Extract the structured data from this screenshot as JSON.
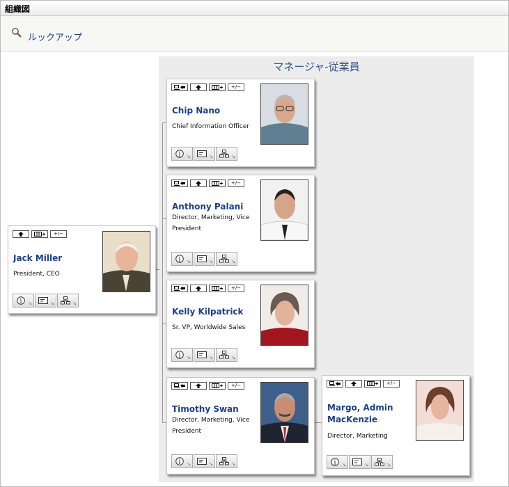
{
  "app": {
    "title": "組織図"
  },
  "toolbar": {
    "lookup_label": "ルックアップ"
  },
  "panel": {
    "title": "マネージャ-従業員"
  },
  "colors": {
    "link": "#1b3f8f",
    "panel_bg": "#ececec",
    "panel_title": "#35588f"
  },
  "icons": {
    "top_buttons": [
      "go-to-manager-icon",
      "up-arrow-icon",
      "show-team-icon",
      "expand-collapse-icon"
    ],
    "bottom_buttons": [
      "info-icon",
      "email-icon",
      "org-chart-icon"
    ]
  },
  "expand_label": "+/−",
  "root": {
    "name": "Jack Miller",
    "title_lines": [
      "President, CEO"
    ]
  },
  "employees": [
    {
      "name": "Chip Nano",
      "title_lines": [
        "Chief Information Officer"
      ]
    },
    {
      "name": "Anthony Palani",
      "title_lines": [
        "Director, Marketing, Vice",
        "President"
      ]
    },
    {
      "name": "Kelly Kilpatrick",
      "title_lines": [
        "Sr. VP, Worldwide Sales"
      ]
    },
    {
      "name": "Timothy Swan",
      "title_lines": [
        "Director, Marketing, Vice",
        "President"
      ]
    }
  ],
  "subordinate": {
    "name_lines": [
      "Margo, Admin",
      "MacKenzie"
    ],
    "title_lines": [
      "Director, Marketing"
    ]
  }
}
